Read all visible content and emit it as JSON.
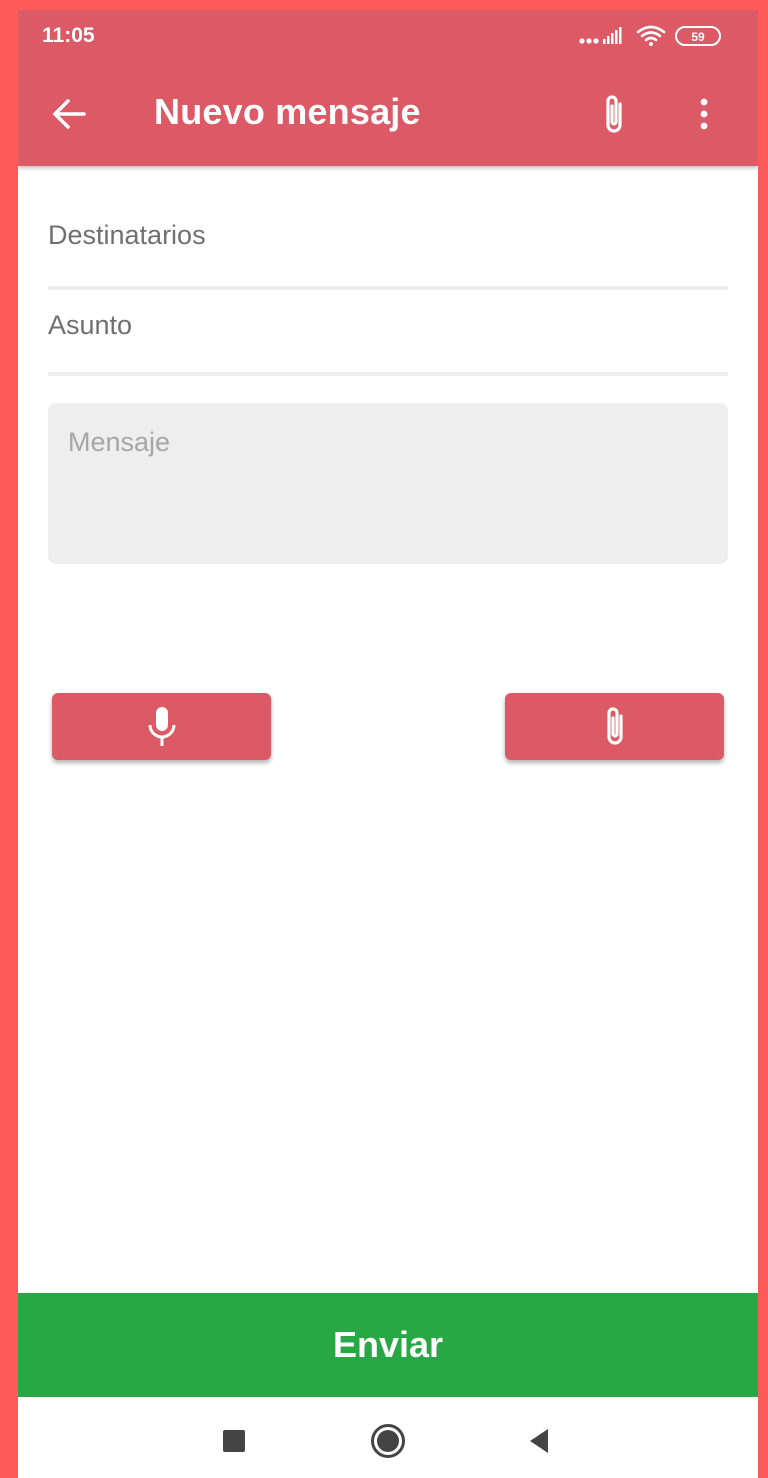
{
  "status_bar": {
    "time": "11:05",
    "battery": "59",
    "icons": [
      "signal-icon",
      "wifi-icon",
      "battery-icon"
    ]
  },
  "app_bar": {
    "title": "Nuevo mensaje",
    "icons": [
      "back-arrow-icon",
      "paperclip-icon",
      "more-vertical-icon"
    ],
    "color": "#DC5A66"
  },
  "form": {
    "recipients_placeholder": "Destinatarios",
    "subject_placeholder": "Asunto",
    "message_placeholder": "Mensaje"
  },
  "actions": {
    "mic_icon": "microphone-icon",
    "attach_icon": "paperclip-icon"
  },
  "send": {
    "label": "Enviar",
    "color": "#27A844"
  },
  "nav_bar": {
    "icons": [
      "recents-square-icon",
      "home-circle-icon",
      "back-triangle-icon"
    ]
  },
  "colors": {
    "background": "#FF5A5A",
    "accent": "#DC5A66"
  }
}
